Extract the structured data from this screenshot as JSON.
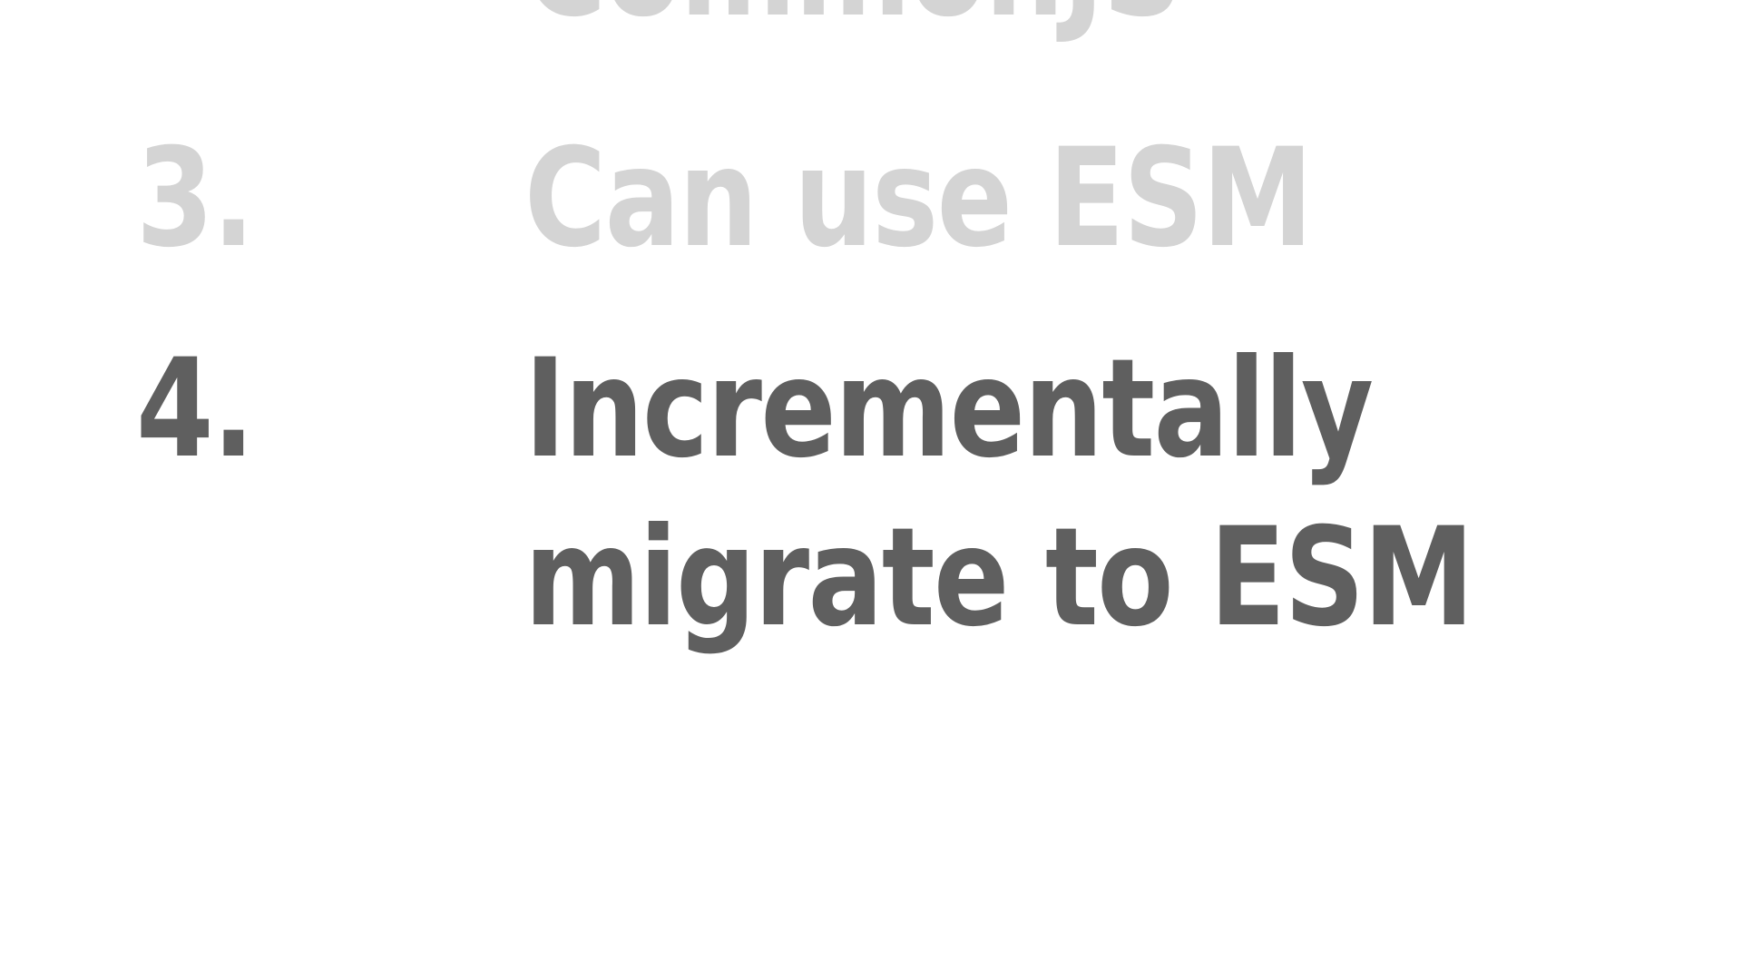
{
  "slide": {
    "items": [
      {
        "number": "",
        "text": "CommonJS",
        "state": "muted"
      },
      {
        "number": "3.",
        "text": "Can use ESM",
        "state": "muted"
      },
      {
        "number": "4.",
        "text": "Incrementally\nmigrate to ESM",
        "state": "active"
      }
    ]
  },
  "colors": {
    "background": "#ffffff",
    "muted_text": "#d4d4d4",
    "active_text": "#5f5f5f"
  }
}
